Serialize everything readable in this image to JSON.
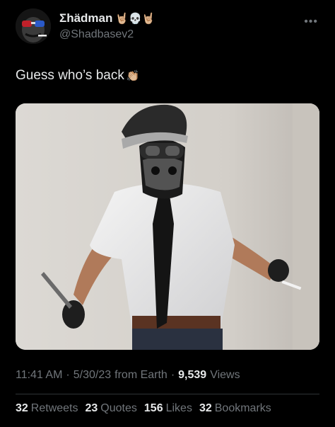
{
  "author": {
    "display_name": "Σhädman",
    "name_emojis": "🤘🏼💀🤘🏼",
    "handle": "@Shadbasev2"
  },
  "more_icon": "more-horizontal-icon",
  "tweet": {
    "text": "Guess who’s back",
    "emoji": "👏🏼"
  },
  "meta": {
    "time": "11:41 AM",
    "date": "5/30/23",
    "source": "from Earth",
    "sep": "·",
    "views_count": "9,539",
    "views_label": "Views"
  },
  "stats": [
    {
      "count": "32",
      "label": "Retweets"
    },
    {
      "count": "23",
      "label": "Quotes"
    },
    {
      "count": "156",
      "label": "Likes"
    },
    {
      "count": "32",
      "label": "Bookmarks"
    }
  ]
}
